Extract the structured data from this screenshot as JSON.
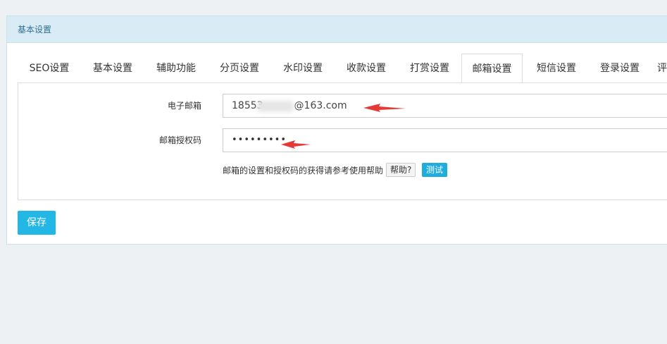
{
  "panel": {
    "title": "基本设置"
  },
  "tabs": [
    {
      "label": "SEO设置"
    },
    {
      "label": "基本设置"
    },
    {
      "label": "辅助功能"
    },
    {
      "label": "分页设置"
    },
    {
      "label": "水印设置"
    },
    {
      "label": "收款设置"
    },
    {
      "label": "打赏设置"
    },
    {
      "label": "邮箱设置",
      "active": true
    },
    {
      "label": "短信设置"
    },
    {
      "label": "登录设置"
    },
    {
      "label": "评"
    }
  ],
  "form": {
    "email_label": "电子邮箱",
    "email_value_prefix": "18553",
    "email_value_suffix": "@163.com",
    "auth_label": "邮箱授权码",
    "auth_value": "•••••••••",
    "help_text": "邮箱的设置和授权码的获得请参考使用帮助",
    "help_button": "帮助?",
    "test_button": "测试"
  },
  "save_button": "保存",
  "colors": {
    "accent": "#23b7e5",
    "heading_bg": "#d9ecf5",
    "annotation_arrow": "#e53935"
  }
}
